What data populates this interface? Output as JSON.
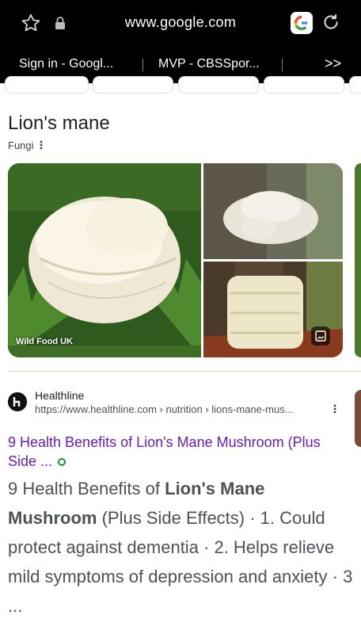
{
  "browser": {
    "url": "www.google.com",
    "tabs": [
      "Sign in - Googl...",
      "MVP - CBSSpor...",
      ">>"
    ]
  },
  "knowledge_panel": {
    "title": "Lion's mane",
    "subtitle": "Fungi",
    "image_credit": "Wild Food UK"
  },
  "result": {
    "site_name": "Healthline",
    "cite": "https://www.healthline.com › nutrition › lions-mane-mus...",
    "title": "9 Health Benefits of Lion's Mane Mushroom (Plus Side ...",
    "snippet_pre": "9 Health Benefits of ",
    "snippet_bold": "Lion's Mane Mushroom",
    "snippet_post": " (Plus Side Effects) · 1. Could protect against dementia · 2. Helps relieve mild symptoms of depression and anxiety · 3 ..."
  },
  "colors": {
    "link_visited": "#681da8",
    "text": "#202124",
    "snippet": "#4d5156"
  },
  "icons": [
    "star-icon",
    "lock-icon",
    "google-icon",
    "reload-icon",
    "more-tabs-icon",
    "kebab-icon",
    "healthline-favicon",
    "image-search-icon"
  ]
}
